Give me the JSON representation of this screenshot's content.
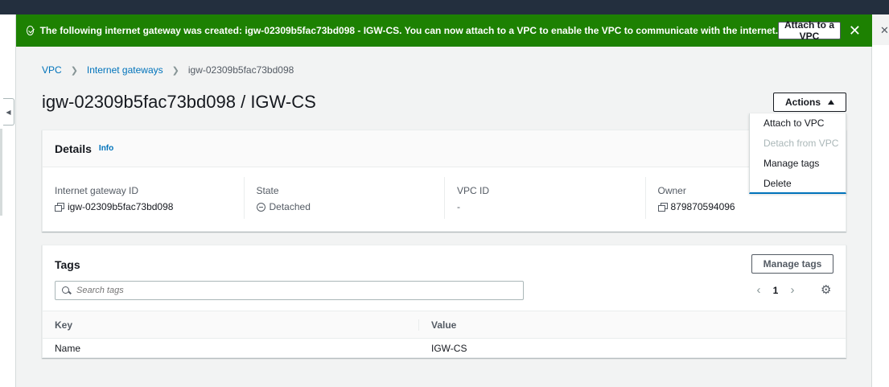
{
  "banner": {
    "message": "The following internet gateway was created: igw-02309b5fac73bd098 - IGW-CS. You can now attach to a VPC to enable the VPC to communicate with the internet.",
    "attach_button": "Attach to a VPC",
    "close_glyph": "✕",
    "status_color": "#1d8102"
  },
  "breadcrumb": {
    "items": [
      "VPC",
      "Internet gateways",
      "igw-02309b5fac73bd098"
    ]
  },
  "page": {
    "title": "igw-02309b5fac73bd098 / IGW-CS",
    "actions_label": "Actions"
  },
  "actions_menu": {
    "items": [
      {
        "label": "Attach to VPC",
        "disabled": false
      },
      {
        "label": "Detach from VPC",
        "disabled": true
      },
      {
        "label": "Manage tags",
        "disabled": false
      },
      {
        "label": "Delete",
        "disabled": false
      }
    ]
  },
  "details": {
    "title": "Details",
    "info": "Info",
    "fields": [
      {
        "label": "Internet gateway ID",
        "value": "igw-02309b5fac73bd098",
        "icon": "copy-icon"
      },
      {
        "label": "State",
        "value": "Detached",
        "icon": "state-icon"
      },
      {
        "label": "VPC ID",
        "value": "-",
        "icon": ""
      },
      {
        "label": "Owner",
        "value": "879870594096",
        "icon": "copy-icon"
      }
    ]
  },
  "tags": {
    "title": "Tags",
    "manage_button": "Manage tags",
    "search_placeholder": "Search tags",
    "page_number": "1",
    "prev_glyph": "‹",
    "next_glyph": "›",
    "columns": [
      "Key",
      "Value"
    ],
    "rows": [
      {
        "key": "Name",
        "value": "IGW-CS"
      }
    ]
  }
}
